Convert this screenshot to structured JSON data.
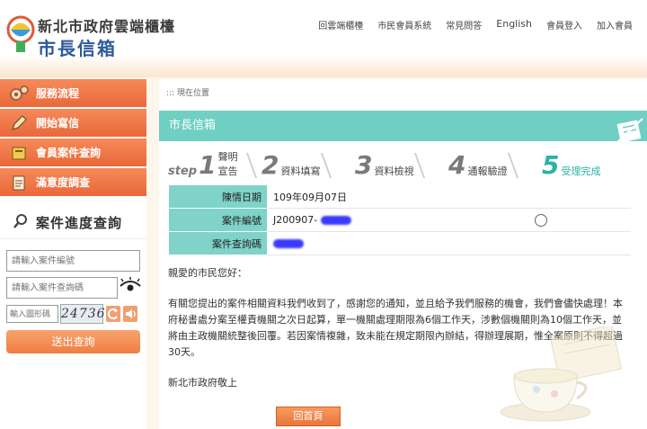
{
  "header": {
    "title": "新北市政府雲端櫃檯",
    "subtitle": "市長信箱",
    "nav": [
      "回雲端櫃檯",
      "市民會員系統",
      "常見問答",
      "English",
      "會員登入",
      "加入會員"
    ]
  },
  "sidebar": {
    "menu": [
      {
        "label": "服務流程",
        "icon": "gears-icon"
      },
      {
        "label": "開始寫信",
        "icon": "pen-icon"
      },
      {
        "label": "會員案件查詢",
        "icon": "folder-icon"
      },
      {
        "label": "滿意度調查",
        "icon": "clipboard-icon"
      }
    ],
    "query": {
      "title": "案件進度查詢",
      "case_no_placeholder": "請輸入案件編號",
      "query_code_placeholder": "請輸入案件查詢碼",
      "captcha_placeholder": "輸入圖形碼",
      "captcha_text": "24736",
      "submit_label": "送出查詢"
    }
  },
  "main": {
    "breadcrumb": "::: 現在位置",
    "section_title": "市長信箱",
    "steps": [
      {
        "num": "1",
        "label": "聲明宣告",
        "prefix": "step"
      },
      {
        "num": "2",
        "label": "資料填寫"
      },
      {
        "num": "3",
        "label": "資料檢視"
      },
      {
        "num": "4",
        "label": "通報驗證"
      },
      {
        "num": "5",
        "label": "受理完成",
        "active": true
      }
    ],
    "info": {
      "date_label": "陳情日期",
      "date_value": "109年09月07日",
      "case_label": "案件編號",
      "case_value": "J200907-",
      "code_label": "案件查詢碼",
      "code_value": ""
    },
    "letter": {
      "greeting": "親愛的市民您好：",
      "body": "有關您提出的案件相關資料我們收到了，感謝您的通知，並且給予我們服務的機會，我們會儘快處理！本府秘書處分案至權責機關之次日起算，單一機關處理期限為6個工作天，涉數個機關則為10個工作天，並將由主政機關統整後回覆。若因案情複雜，致未能在規定期限內辦結，得辦理展期，惟全案原則不得超過30天。",
      "sign": "新北市政府敬上"
    },
    "home_button": "回首頁"
  }
}
